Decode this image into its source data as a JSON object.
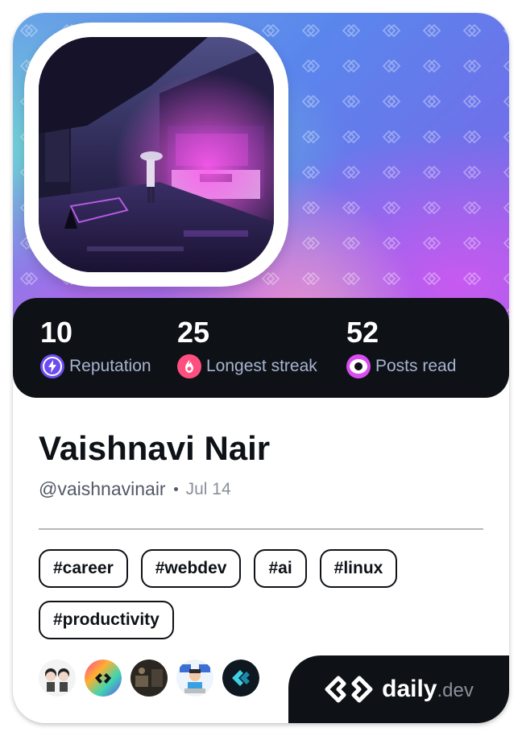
{
  "stats": [
    {
      "value": "10",
      "label": "Reputation",
      "icon": "reputation-bolt-icon",
      "color": "#6c4cf0"
    },
    {
      "value": "25",
      "label": "Longest streak",
      "icon": "streak-flame-icon",
      "color": "#ff4f7f"
    },
    {
      "value": "52",
      "label": "Posts read",
      "icon": "posts-read-eye-icon",
      "color": "#d94cf0"
    }
  ],
  "profile": {
    "name": "Vaishnavi Nair",
    "handle": "@vaishnavinair",
    "joined": "Jul 14"
  },
  "tags": [
    "#career",
    "#webdev",
    "#ai",
    "#linux",
    "#productivity"
  ],
  "sources": [
    {
      "name": "source-avatar-group-icon"
    },
    {
      "name": "source-daily-dev-colorful-icon"
    },
    {
      "name": "source-dark-photo-icon"
    },
    {
      "name": "source-developer-cartoon-icon"
    },
    {
      "name": "source-cyan-logo-icon"
    }
  ],
  "brand": {
    "name": "daily",
    "suffix": ".dev"
  }
}
